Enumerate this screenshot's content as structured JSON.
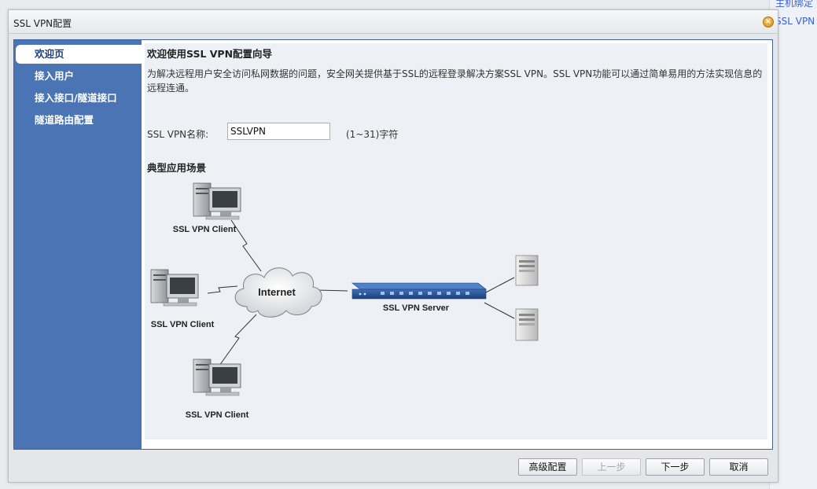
{
  "background": {
    "links": [
      "主机绑定",
      "SSL VPN"
    ]
  },
  "dialog": {
    "title": "SSL VPN配置",
    "close_icon": "close-icon"
  },
  "nav": {
    "items": [
      {
        "label": "欢迎页",
        "active": true
      },
      {
        "label": "接入用户",
        "active": false
      },
      {
        "label": "接入接口/隧道接口",
        "active": false
      },
      {
        "label": "隧道路由配置",
        "active": false
      }
    ]
  },
  "main": {
    "heading": "欢迎使用SSL VPN配置向导",
    "description": "为解决远程用户安全访问私网数据的问题，安全网关提供基于SSL的远程登录解决方案SSL VPN。SSL VPN功能可以通过简单易用的方法实现信息的远程连通。",
    "name_label": "SSL VPN名称:",
    "name_value": "SSLVPN",
    "name_hint": "(1~31)字符",
    "scene_heading": "典型应用场景"
  },
  "diagram": {
    "client_label": "SSL VPN Client",
    "internet_label": "Internet",
    "server_label": "SSL VPN Server"
  },
  "buttons": {
    "advanced": "高级配置",
    "prev": "上一步",
    "next": "下一步",
    "cancel": "取消"
  }
}
